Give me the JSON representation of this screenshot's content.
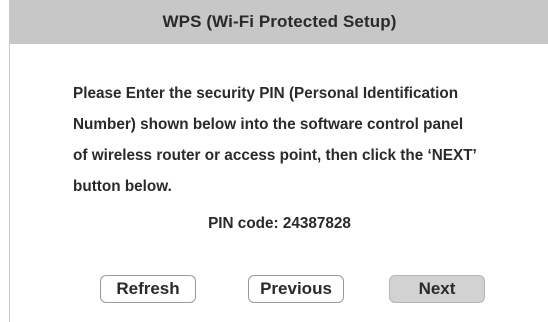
{
  "dialog": {
    "title": "WPS (Wi-Fi Protected Setup)",
    "message_lines": [
      "Please Enter the security PIN (Personal Identification",
      "Number) shown below into the software control panel",
      "of wireless router or access point, then click the ‘NEXT’",
      "button below."
    ],
    "pin_text": "PIN code: 24387828"
  },
  "buttons": {
    "refresh_label": "Refresh",
    "previous_label": "Previous",
    "next_label": "Next"
  },
  "colors": {
    "titlebar_bg": "#c7c7c7",
    "text": "#2a2a2a",
    "next_button_bg": "#d2d2d2"
  }
}
